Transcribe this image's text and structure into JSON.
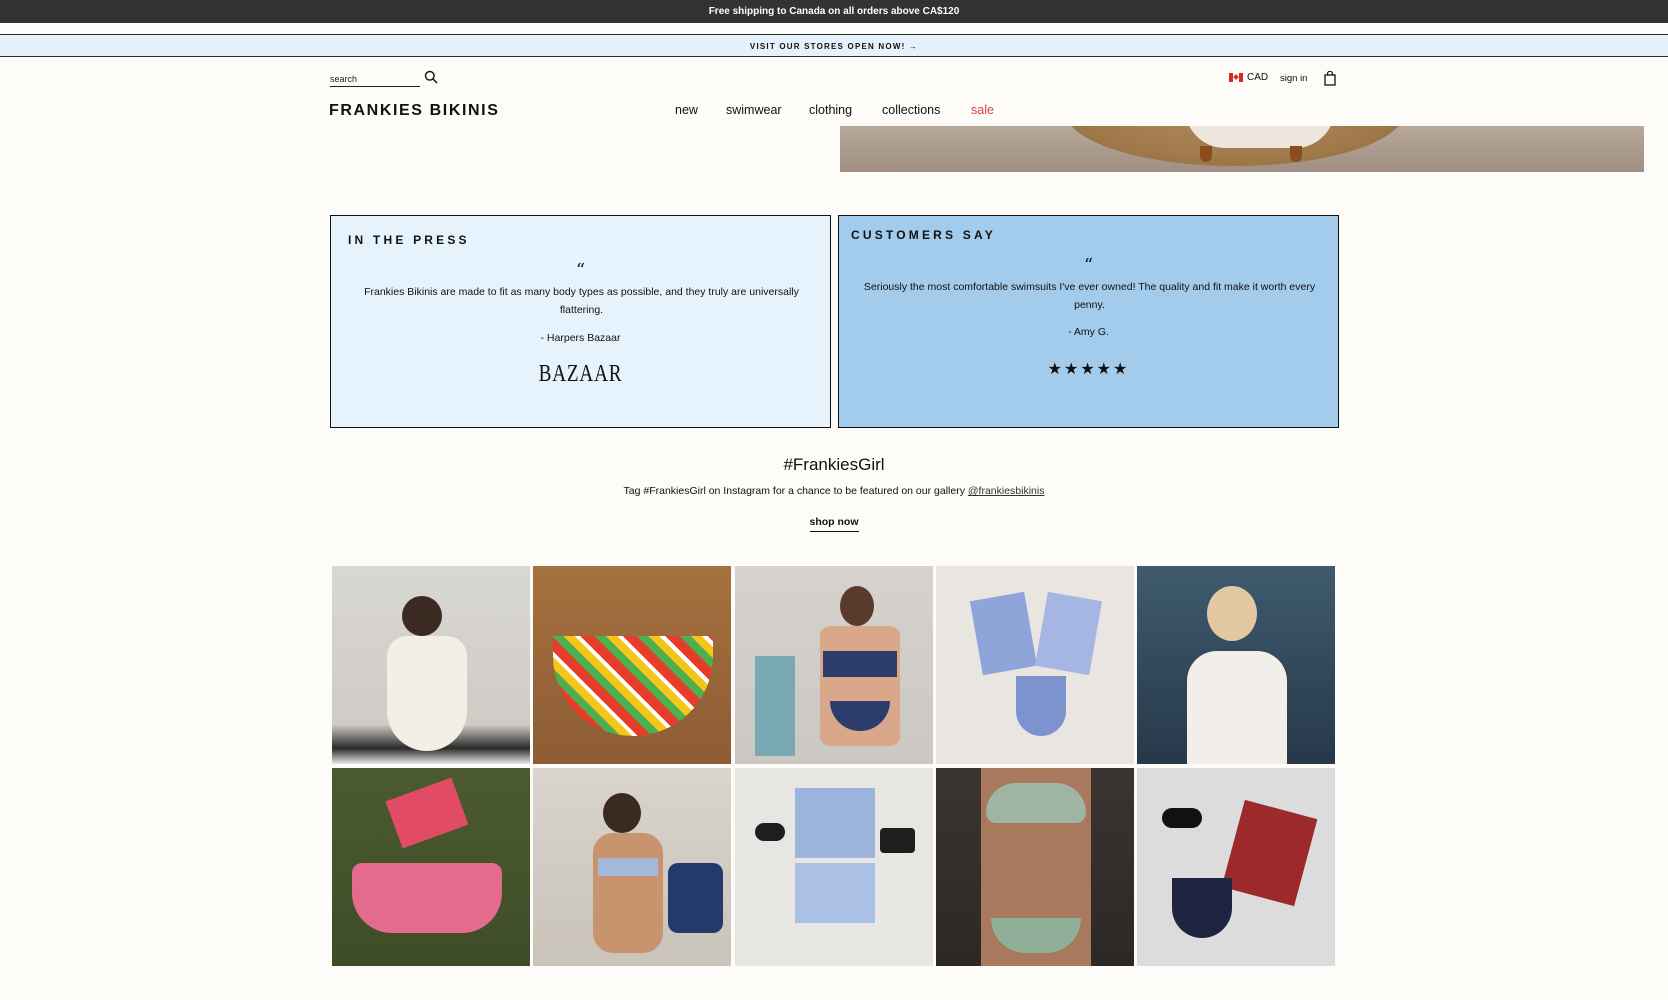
{
  "announcement": {
    "shipping": "Free shipping to Canada on all orders above CA$120",
    "stores": "VISIT OUR STORES OPEN NOW! →"
  },
  "header": {
    "search_placeholder": "search",
    "logo": "FRANKIES BIKINIS",
    "nav": [
      "new",
      "swimwear",
      "clothing",
      "collections",
      "sale"
    ],
    "currency": "CAD",
    "sign_in": "sign in"
  },
  "press": {
    "title": "IN THE PRESS",
    "quote_mark": "“",
    "quote": "Frankies Bikinis are made to fit as many body types as possible, and they truly are universally flattering.",
    "author": "- Harpers Bazaar",
    "logo": "BAZAAR"
  },
  "customers": {
    "title": "CUSTOMERS SAY",
    "quote_mark": "“",
    "quote": "Seriously the most comfortable swimsuits I've ever owned! The quality and fit make it worth every penny.",
    "author": "- Amy G.",
    "stars": "★★★★★",
    "rating": 5
  },
  "gallery": {
    "title": "#FrankiesGirl",
    "subtitle": "Tag #FrankiesGirl on Instagram for a chance to be featured on our gallery",
    "handle": "@frankiesbikinis",
    "cta": "shop now"
  },
  "colors": {
    "press_bg": "#e6f3fd",
    "customers_bg": "#a3cbeb",
    "sale": "#e0413a",
    "top_bar": "#333333"
  }
}
